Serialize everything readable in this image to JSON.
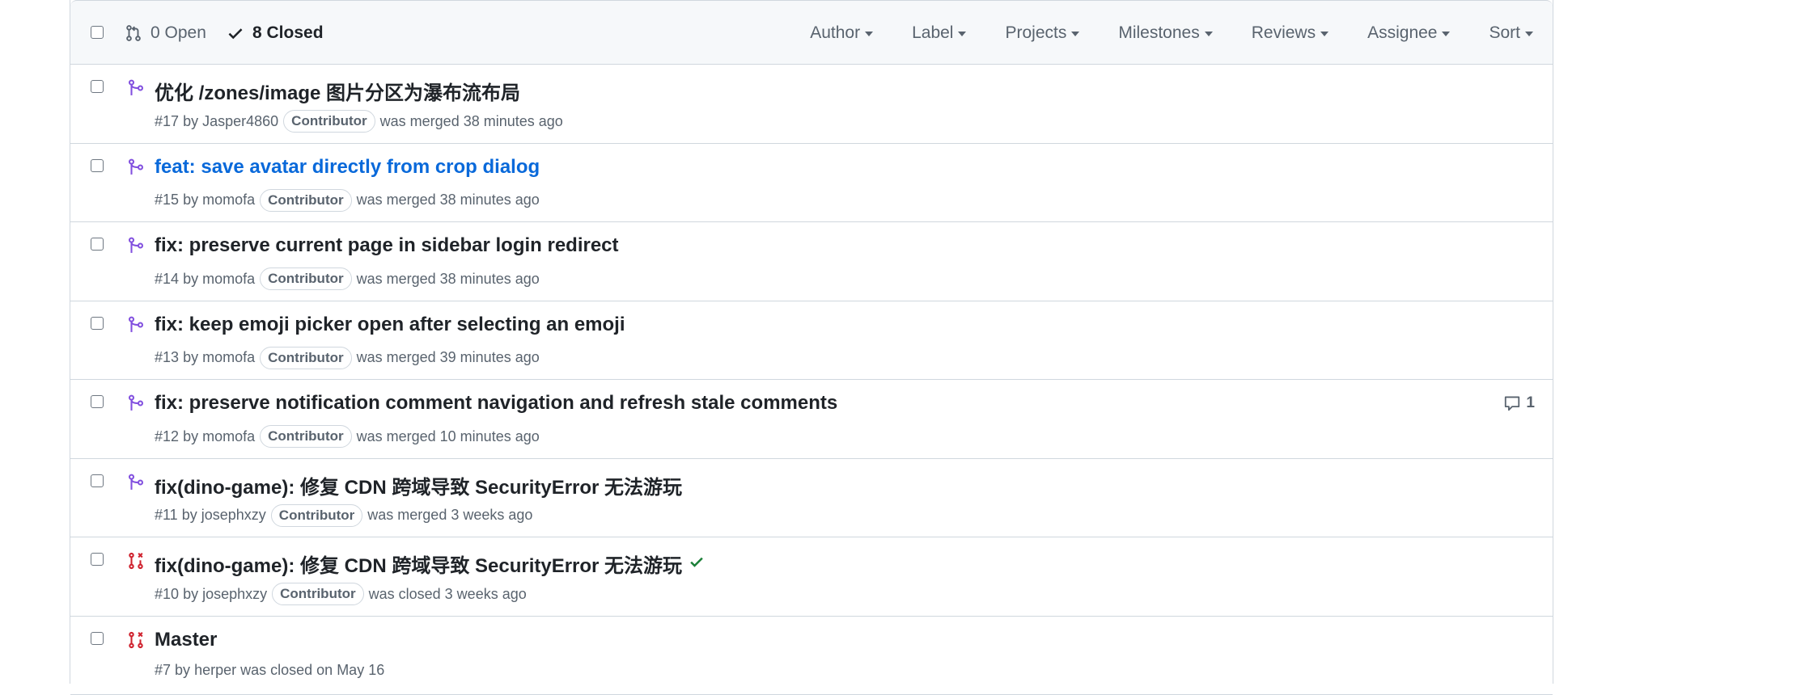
{
  "toolbar": {
    "open_label": "0 Open",
    "closed_label": "8 Closed",
    "filters": [
      "Author",
      "Label",
      "Projects",
      "Milestones",
      "Reviews",
      "Assignee",
      "Sort"
    ]
  },
  "pull_requests": [
    {
      "title": "优化 /zones/image 图片分区为瀑布流布局",
      "number": "#17",
      "by": "by",
      "author": "Jasper4860",
      "badge": "Contributor",
      "status": "was merged 38 minutes ago",
      "state": "merged",
      "state_icon": "git-merge-icon",
      "comments": ""
    },
    {
      "title": "feat: save avatar directly from crop dialog",
      "number": "#15",
      "by": "by",
      "author": "momofa",
      "badge": "Contributor",
      "status": "was merged 38 minutes ago",
      "state": "merged",
      "state_icon": "git-merge-icon",
      "comments": "",
      "hovered": true
    },
    {
      "title": "fix: preserve current page in sidebar login redirect",
      "number": "#14",
      "by": "by",
      "author": "momofa",
      "badge": "Contributor",
      "status": "was merged 38 minutes ago",
      "state": "merged",
      "state_icon": "git-merge-icon",
      "comments": ""
    },
    {
      "title": "fix: keep emoji picker open after selecting an emoji",
      "number": "#13",
      "by": "by",
      "author": "momofa",
      "badge": "Contributor",
      "status": "was merged 39 minutes ago",
      "state": "merged",
      "state_icon": "git-merge-icon",
      "comments": ""
    },
    {
      "title": "fix: preserve notification comment navigation and refresh stale comments",
      "number": "#12",
      "by": "by",
      "author": "momofa",
      "badge": "Contributor",
      "status": "was merged 10 minutes ago",
      "state": "merged",
      "state_icon": "git-merge-icon",
      "comments": "1"
    },
    {
      "title": "fix(dino-game): 修复 CDN 跨域导致 SecurityError 无法游玩",
      "number": "#11",
      "by": "by",
      "author": "josephxzy",
      "badge": "Contributor",
      "status": "was merged 3 weeks ago",
      "state": "merged",
      "state_icon": "git-merge-icon",
      "comments": ""
    },
    {
      "title": "fix(dino-game): 修复 CDN 跨域导致 SecurityError 无法游玩",
      "number": "#10",
      "by": "by",
      "author": "josephxzy",
      "badge": "Contributor",
      "status": "was closed 3 weeks ago",
      "state": "closed",
      "state_icon": "git-pull-request-closed-icon",
      "comments": "",
      "checks": "passed"
    },
    {
      "title": "Master",
      "number": "#7",
      "by": "by",
      "author": "herper",
      "badge": "",
      "status": "was closed on May 16",
      "state": "closed",
      "state_icon": "git-pull-request-closed-icon",
      "comments": ""
    }
  ],
  "colors": {
    "merged": "#8250df",
    "closed": "#cf222e",
    "link": "#0969da",
    "success": "#1a7f37"
  }
}
